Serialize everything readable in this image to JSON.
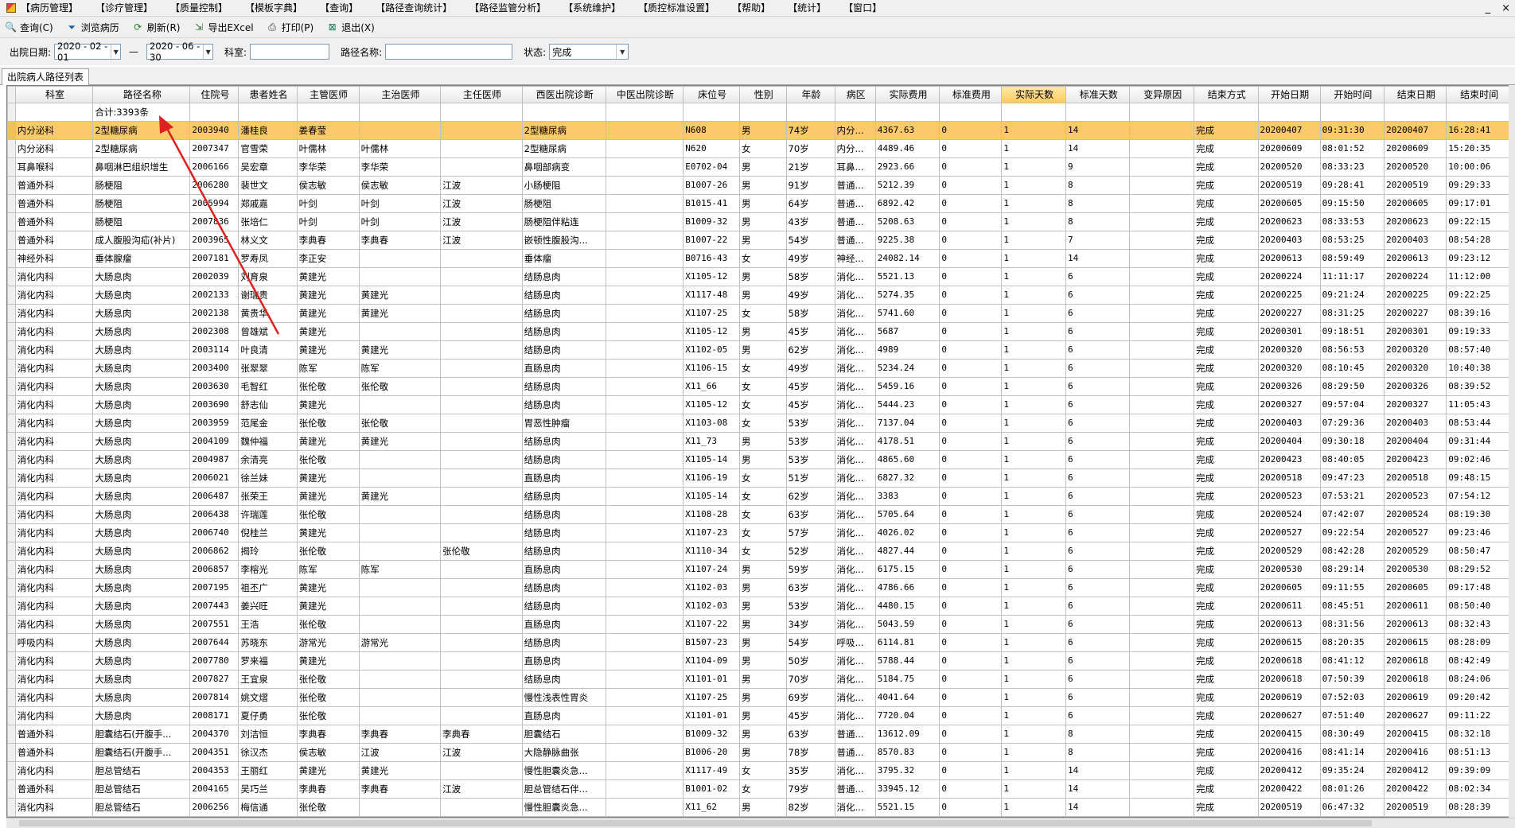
{
  "menu": [
    "【病历管理】",
    "【诊疗管理】",
    "【质量控制】",
    "【模板字典】",
    "【查询】",
    "【路径查询统计】",
    "【路径监管分析】",
    "【系统维护】",
    "【质控标准设置】",
    "【帮助】",
    "【统计】",
    "【窗口】"
  ],
  "window_controls": {
    "min": "_",
    "close": "×"
  },
  "toolbar": [
    {
      "label": "查询(C)",
      "icon": "search-icon"
    },
    {
      "label": "浏览病历",
      "icon": "filter-icon"
    },
    {
      "label": "刷新(R)",
      "icon": "refresh-icon"
    },
    {
      "label": "导出EXcel",
      "icon": "export-icon"
    },
    {
      "label": "打印(P)",
      "icon": "print-icon"
    },
    {
      "label": "退出(X)",
      "icon": "exit-icon"
    }
  ],
  "filters": {
    "discharge_date_label": "出院日期:",
    "date_from": "2020 - 02 - 01",
    "date_sep": "—",
    "date_to": "2020 - 06 - 30",
    "dept_label": "科室:",
    "dept_value": "",
    "path_label": "路径名称:",
    "path_value": "",
    "status_label": "状态:",
    "status_value": "完成"
  },
  "tab_label": "出院病人路径列表",
  "columns": [
    "科室",
    "路径名称",
    "住院号",
    "患者姓名",
    "主管医师",
    "主治医师",
    "主任医师",
    "西医出院诊断",
    "中医出院诊断",
    "床位号",
    "性别",
    "年龄",
    "病区",
    "实际费用",
    "标准费用",
    "实际天数",
    "标准天数",
    "变异原因",
    "结束方式",
    "开始日期",
    "开始时间",
    "结束日期",
    "结束时间"
  ],
  "summary": "合计:3393条",
  "rows": [
    [
      "内分泌科",
      "2型糖尿病",
      "2003940",
      "潘桂良",
      "姜春莹",
      "",
      "",
      "2型糖尿病",
      "",
      "N608",
      "男",
      "74岁",
      "内分...",
      "4367.63",
      "0",
      "1",
      "14",
      "",
      "完成",
      "20200407",
      "09:31:30",
      "20200407",
      "16:28:41"
    ],
    [
      "内分泌科",
      "2型糖尿病",
      "2007347",
      "官雪荣",
      "叶儒林",
      "叶儒林",
      "",
      "2型糖尿病",
      "",
      "N620",
      "女",
      "70岁",
      "内分...",
      "4489.46",
      "0",
      "1",
      "14",
      "",
      "完成",
      "20200609",
      "08:01:52",
      "20200609",
      "15:20:35"
    ],
    [
      "耳鼻喉科",
      "鼻咽淋巴组织增生",
      "2006166",
      "吴宏章",
      "李华荣",
      "李华荣",
      "",
      "鼻咽部病变",
      "",
      "E0702-04",
      "男",
      "21岁",
      "耳鼻...",
      "2923.66",
      "0",
      "1",
      "9",
      "",
      "完成",
      "20200520",
      "08:33:23",
      "20200520",
      "10:00:06"
    ],
    [
      "普通外科",
      "肠梗阻",
      "2006280",
      "裴世文",
      "侯志敏",
      "侯志敏",
      "江波",
      "小肠梗阻",
      "",
      "B1007-26",
      "男",
      "91岁",
      "普通...",
      "5212.39",
      "0",
      "1",
      "8",
      "",
      "完成",
      "20200519",
      "09:28:41",
      "20200519",
      "09:29:33"
    ],
    [
      "普通外科",
      "肠梗阻",
      "2005994",
      "郑戚嘉",
      "叶剑",
      "叶剑",
      "江波",
      "肠梗阻",
      "",
      "B1015-41",
      "男",
      "64岁",
      "普通...",
      "6892.42",
      "0",
      "1",
      "8",
      "",
      "完成",
      "20200605",
      "09:15:50",
      "20200605",
      "09:17:01"
    ],
    [
      "普通外科",
      "肠梗阻",
      "2007836",
      "张培仁",
      "叶剑",
      "叶剑",
      "江波",
      "肠梗阻伴粘连",
      "",
      "B1009-32",
      "男",
      "43岁",
      "普通...",
      "5208.63",
      "0",
      "1",
      "8",
      "",
      "完成",
      "20200623",
      "08:33:53",
      "20200623",
      "09:22:15"
    ],
    [
      "普通外科",
      "成人腹股沟疝(补片)",
      "2003965",
      "林义文",
      "李典春",
      "李典春",
      "江波",
      "嵌顿性腹股沟...",
      "",
      "B1007-22",
      "男",
      "54岁",
      "普通...",
      "9225.38",
      "0",
      "1",
      "7",
      "",
      "完成",
      "20200403",
      "08:53:25",
      "20200403",
      "08:54:28"
    ],
    [
      "神经外科",
      "垂体腺瘤",
      "2007181",
      "罗寿凤",
      "李正安",
      "",
      "",
      "垂体瘤",
      "",
      "B0716-43",
      "女",
      "49岁",
      "神经...",
      "24082.14",
      "0",
      "1",
      "14",
      "",
      "完成",
      "20200613",
      "08:59:49",
      "20200613",
      "09:23:12"
    ],
    [
      "消化内科",
      "大肠息肉",
      "2002039",
      "刘育泉",
      "黄建光",
      "",
      "",
      "结肠息肉",
      "",
      "X1105-12",
      "男",
      "58岁",
      "消化...",
      "5521.13",
      "0",
      "1",
      "6",
      "",
      "完成",
      "20200224",
      "11:11:17",
      "20200224",
      "11:12:00"
    ],
    [
      "消化内科",
      "大肠息肉",
      "2002133",
      "谢瑞贵",
      "黄建光",
      "黄建光",
      "",
      "结肠息肉",
      "",
      "X1117-48",
      "男",
      "49岁",
      "消化...",
      "5274.35",
      "0",
      "1",
      "6",
      "",
      "完成",
      "20200225",
      "09:21:24",
      "20200225",
      "09:22:25"
    ],
    [
      "消化内科",
      "大肠息肉",
      "2002138",
      "黄贵华",
      "黄建光",
      "黄建光",
      "",
      "结肠息肉",
      "",
      "X1107-25",
      "女",
      "58岁",
      "消化...",
      "5741.60",
      "0",
      "1",
      "6",
      "",
      "完成",
      "20200227",
      "08:31:25",
      "20200227",
      "08:39:16"
    ],
    [
      "消化内科",
      "大肠息肉",
      "2002308",
      "曾雄斌",
      "黄建光",
      "",
      "",
      "结肠息肉",
      "",
      "X1105-12",
      "男",
      "45岁",
      "消化...",
      "5687",
      "0",
      "1",
      "6",
      "",
      "完成",
      "20200301",
      "09:18:51",
      "20200301",
      "09:19:33"
    ],
    [
      "消化内科",
      "大肠息肉",
      "2003114",
      "叶良清",
      "黄建光",
      "黄建光",
      "",
      "结肠息肉",
      "",
      "X1102-05",
      "男",
      "62岁",
      "消化...",
      "4989",
      "0",
      "1",
      "6",
      "",
      "完成",
      "20200320",
      "08:56:53",
      "20200320",
      "08:57:40"
    ],
    [
      "消化内科",
      "大肠息肉",
      "2003400",
      "张翠翠",
      "陈军",
      "陈军",
      "",
      "直肠息肉",
      "",
      "X1106-15",
      "女",
      "49岁",
      "消化...",
      "5234.24",
      "0",
      "1",
      "6",
      "",
      "完成",
      "20200320",
      "08:10:45",
      "20200320",
      "10:40:38"
    ],
    [
      "消化内科",
      "大肠息肉",
      "2003630",
      "毛智红",
      "张伦敬",
      "张伦敬",
      "",
      "结肠息肉",
      "",
      "X11_66",
      "女",
      "45岁",
      "消化...",
      "5459.16",
      "0",
      "1",
      "6",
      "",
      "完成",
      "20200326",
      "08:29:50",
      "20200326",
      "08:39:52"
    ],
    [
      "消化内科",
      "大肠息肉",
      "2003690",
      "舒志仙",
      "黄建光",
      "",
      "",
      "结肠息肉",
      "",
      "X1105-12",
      "女",
      "45岁",
      "消化...",
      "5444.23",
      "0",
      "1",
      "6",
      "",
      "完成",
      "20200327",
      "09:57:04",
      "20200327",
      "11:05:43"
    ],
    [
      "消化内科",
      "大肠息肉",
      "2003959",
      "范尾金",
      "张伦敬",
      "张伦敬",
      "",
      "胃恶性肿瘤",
      "",
      "X1103-08",
      "女",
      "53岁",
      "消化...",
      "7137.04",
      "0",
      "1",
      "6",
      "",
      "完成",
      "20200403",
      "07:29:36",
      "20200403",
      "08:53:44"
    ],
    [
      "消化内科",
      "大肠息肉",
      "2004109",
      "魏仲福",
      "黄建光",
      "黄建光",
      "",
      "结肠息肉",
      "",
      "X11_73",
      "男",
      "53岁",
      "消化...",
      "4178.51",
      "0",
      "1",
      "6",
      "",
      "完成",
      "20200404",
      "09:30:18",
      "20200404",
      "09:31:44"
    ],
    [
      "消化内科",
      "大肠息肉",
      "2004987",
      "余清亮",
      "张伦敬",
      "",
      "",
      "结肠息肉",
      "",
      "X1105-14",
      "男",
      "53岁",
      "消化...",
      "4865.60",
      "0",
      "1",
      "6",
      "",
      "完成",
      "20200423",
      "08:40:05",
      "20200423",
      "09:02:46"
    ],
    [
      "消化内科",
      "大肠息肉",
      "2006021",
      "徐兰妹",
      "黄建光",
      "",
      "",
      "直肠息肉",
      "",
      "X1106-19",
      "女",
      "51岁",
      "消化...",
      "6827.32",
      "0",
      "1",
      "6",
      "",
      "完成",
      "20200518",
      "09:47:23",
      "20200518",
      "09:48:15"
    ],
    [
      "消化内科",
      "大肠息肉",
      "2006487",
      "张荣王",
      "黄建光",
      "黄建光",
      "",
      "结肠息肉",
      "",
      "X1105-14",
      "女",
      "62岁",
      "消化...",
      "3383",
      "0",
      "1",
      "6",
      "",
      "完成",
      "20200523",
      "07:53:21",
      "20200523",
      "07:54:12"
    ],
    [
      "消化内科",
      "大肠息肉",
      "2006438",
      "许瑞莲",
      "张伦敬",
      "",
      "",
      "结肠息肉",
      "",
      "X1108-28",
      "女",
      "63岁",
      "消化...",
      "5705.64",
      "0",
      "1",
      "6",
      "",
      "完成",
      "20200524",
      "07:42:07",
      "20200524",
      "08:19:30"
    ],
    [
      "消化内科",
      "大肠息肉",
      "2006740",
      "倪桂兰",
      "黄建光",
      "",
      "",
      "结肠息肉",
      "",
      "X1107-23",
      "女",
      "57岁",
      "消化...",
      "4026.02",
      "0",
      "1",
      "6",
      "",
      "完成",
      "20200527",
      "09:22:54",
      "20200527",
      "09:23:46"
    ],
    [
      "消化内科",
      "大肠息肉",
      "2006862",
      "揭玲",
      "张伦敬",
      "",
      "张伦敬",
      "结肠息肉",
      "",
      "X1110-34",
      "女",
      "52岁",
      "消化...",
      "4827.44",
      "0",
      "1",
      "6",
      "",
      "完成",
      "20200529",
      "08:42:28",
      "20200529",
      "08:50:47"
    ],
    [
      "消化内科",
      "大肠息肉",
      "2006857",
      "李榕光",
      "陈军",
      "陈军",
      "",
      "直肠息肉",
      "",
      "X1107-24",
      "男",
      "59岁",
      "消化...",
      "6175.15",
      "0",
      "1",
      "6",
      "",
      "完成",
      "20200530",
      "08:29:14",
      "20200530",
      "08:29:52"
    ],
    [
      "消化内科",
      "大肠息肉",
      "2007195",
      "祖丕广",
      "黄建光",
      "",
      "",
      "结肠息肉",
      "",
      "X1102-03",
      "男",
      "63岁",
      "消化...",
      "4786.66",
      "0",
      "1",
      "6",
      "",
      "完成",
      "20200605",
      "09:11:55",
      "20200605",
      "09:17:48"
    ],
    [
      "消化内科",
      "大肠息肉",
      "2007443",
      "姜兴旺",
      "黄建光",
      "",
      "",
      "结肠息肉",
      "",
      "X1102-03",
      "男",
      "53岁",
      "消化...",
      "4480.15",
      "0",
      "1",
      "6",
      "",
      "完成",
      "20200611",
      "08:45:51",
      "20200611",
      "08:50:40"
    ],
    [
      "消化内科",
      "大肠息肉",
      "2007551",
      "王浩",
      "张伦敬",
      "",
      "",
      "直肠息肉",
      "",
      "X1107-22",
      "男",
      "34岁",
      "消化...",
      "5043.59",
      "0",
      "1",
      "6",
      "",
      "完成",
      "20200613",
      "08:31:56",
      "20200613",
      "08:32:43"
    ],
    [
      "呼吸内科",
      "大肠息肉",
      "2007644",
      "苏晓东",
      "游常光",
      "游常光",
      "",
      "结肠息肉",
      "",
      "B1507-23",
      "男",
      "54岁",
      "呼吸...",
      "6114.81",
      "0",
      "1",
      "6",
      "",
      "完成",
      "20200615",
      "08:20:35",
      "20200615",
      "08:28:09"
    ],
    [
      "消化内科",
      "大肠息肉",
      "2007780",
      "罗来福",
      "黄建光",
      "",
      "",
      "直肠息肉",
      "",
      "X1104-09",
      "男",
      "50岁",
      "消化...",
      "5788.44",
      "0",
      "1",
      "6",
      "",
      "完成",
      "20200618",
      "08:41:12",
      "20200618",
      "08:42:49"
    ],
    [
      "消化内科",
      "大肠息肉",
      "2007827",
      "王宜泉",
      "张伦敬",
      "",
      "",
      "结肠息肉",
      "",
      "X1101-01",
      "男",
      "70岁",
      "消化...",
      "5184.75",
      "0",
      "1",
      "6",
      "",
      "完成",
      "20200618",
      "07:50:39",
      "20200618",
      "08:24:06"
    ],
    [
      "消化内科",
      "大肠息肉",
      "2007814",
      "姚文熠",
      "张伦敬",
      "",
      "",
      "慢性浅表性胃炎",
      "",
      "X1107-25",
      "男",
      "69岁",
      "消化...",
      "4041.64",
      "0",
      "1",
      "6",
      "",
      "完成",
      "20200619",
      "07:52:03",
      "20200619",
      "09:20:42"
    ],
    [
      "消化内科",
      "大肠息肉",
      "2008171",
      "夏仔勇",
      "张伦敬",
      "",
      "",
      "直肠息肉",
      "",
      "X1101-01",
      "男",
      "45岁",
      "消化...",
      "7720.04",
      "0",
      "1",
      "6",
      "",
      "完成",
      "20200627",
      "07:51:40",
      "20200627",
      "09:11:22"
    ],
    [
      "普通外科",
      "胆囊结石(开腹手...",
      "2004370",
      "刘洁恒",
      "李典春",
      "李典春",
      "李典春",
      "胆囊结石",
      "",
      "B1009-32",
      "男",
      "63岁",
      "普通...",
      "13612.09",
      "0",
      "1",
      "8",
      "",
      "完成",
      "20200415",
      "08:30:49",
      "20200415",
      "08:32:18"
    ],
    [
      "普通外科",
      "胆囊结石(开腹手...",
      "2004351",
      "徐汉杰",
      "侯志敏",
      "江波",
      "江波",
      "大隐静脉曲张",
      "",
      "B1006-20",
      "男",
      "78岁",
      "普通...",
      "8570.83",
      "0",
      "1",
      "8",
      "",
      "完成",
      "20200416",
      "08:41:14",
      "20200416",
      "08:51:13"
    ],
    [
      "消化内科",
      "胆总管结石",
      "2004353",
      "王丽红",
      "黄建光",
      "黄建光",
      "",
      "慢性胆囊炎急...",
      "",
      "X1117-49",
      "女",
      "35岁",
      "消化...",
      "3795.32",
      "0",
      "1",
      "14",
      "",
      "完成",
      "20200412",
      "09:35:24",
      "20200412",
      "09:39:09"
    ],
    [
      "普通外科",
      "胆总管结石",
      "2004165",
      "吴巧兰",
      "李典春",
      "李典春",
      "江波",
      "胆总管结石伴...",
      "",
      "B1001-02",
      "女",
      "79岁",
      "普通...",
      "33945.12",
      "0",
      "1",
      "14",
      "",
      "完成",
      "20200422",
      "08:01:26",
      "20200422",
      "08:02:34"
    ],
    [
      "消化内科",
      "胆总管结石",
      "2006256",
      "梅信通",
      "张伦敬",
      "",
      "",
      "慢性胆囊炎急...",
      "",
      "X11_62",
      "男",
      "82岁",
      "消化...",
      "5521.15",
      "0",
      "1",
      "14",
      "",
      "完成",
      "20200519",
      "06:47:32",
      "20200519",
      "08:28:39"
    ]
  ],
  "colors": {
    "selected_row": "#fcc96b",
    "sorted_header": "#ffc85a",
    "annotation_arrow": "#e02020"
  }
}
